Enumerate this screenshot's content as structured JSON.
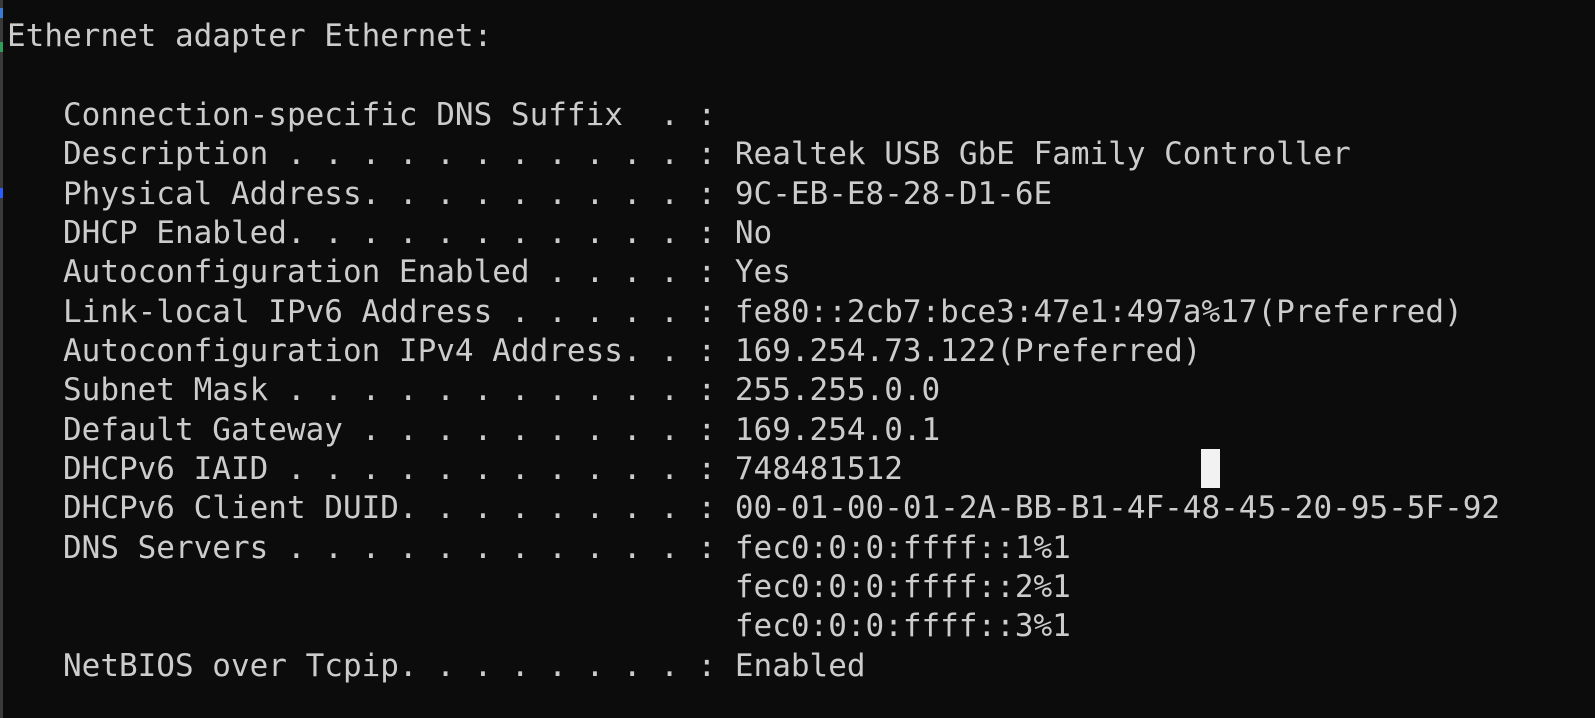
{
  "console": {
    "heading": "Ethernet adapter Ethernet:",
    "lines": [
      "   Connection-specific DNS Suffix  . :",
      "   Description . . . . . . . . . . . : Realtek USB GbE Family Controller",
      "   Physical Address. . . . . . . . . : 9C-EB-E8-28-D1-6E",
      "   DHCP Enabled. . . . . . . . . . . : No",
      "   Autoconfiguration Enabled . . . . : Yes",
      "   Link-local IPv6 Address . . . . . : fe80::2cb7:bce3:47e1:497a%17(Preferred)",
      "   Autoconfiguration IPv4 Address. . : 169.254.73.122(Preferred)",
      "   Subnet Mask . . . . . . . . . . . : 255.255.0.0",
      "   Default Gateway . . . . . . . . . : 169.254.0.1",
      "   DHCPv6 IAID . . . . . . . . . . . : 748481512",
      "   DHCPv6 Client DUID. . . . . . . . : 00-01-00-01-2A-BB-B1-4F-48-45-20-95-5F-92",
      "   DNS Servers . . . . . . . . . . . : fec0:0:0:ffff::1%1",
      "                                       fec0:0:0:ffff::2%1",
      "                                       fec0:0:0:ffff::3%1",
      "   NetBIOS over Tcpip. . . . . . . . : Enabled"
    ]
  },
  "colors": {
    "background": "#0c0c0c",
    "text": "#cccccc",
    "cursor": "#f2f2f2"
  }
}
